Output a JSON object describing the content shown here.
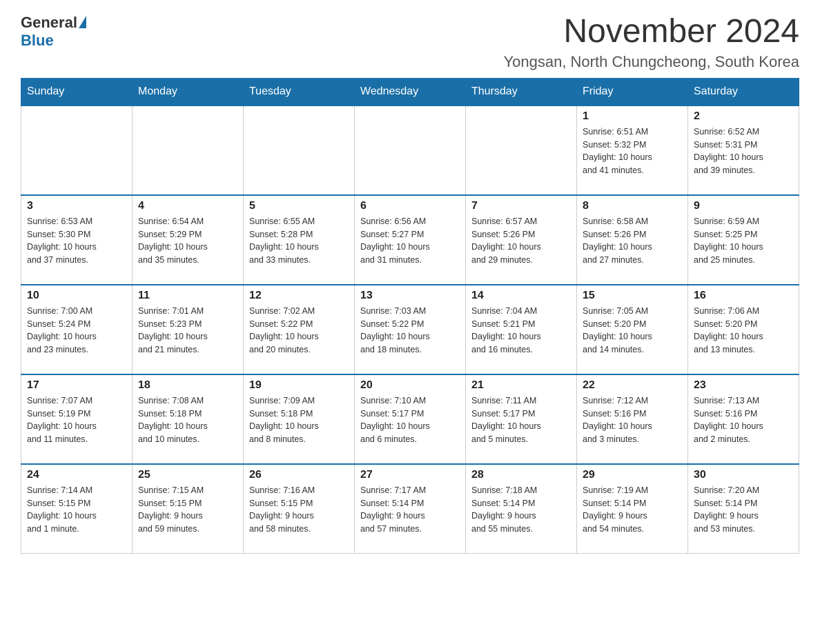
{
  "logo": {
    "general": "General",
    "blue": "Blue"
  },
  "title": "November 2024",
  "location": "Yongsan, North Chungcheong, South Korea",
  "headers": [
    "Sunday",
    "Monday",
    "Tuesday",
    "Wednesday",
    "Thursday",
    "Friday",
    "Saturday"
  ],
  "weeks": [
    [
      {
        "day": "",
        "info": ""
      },
      {
        "day": "",
        "info": ""
      },
      {
        "day": "",
        "info": ""
      },
      {
        "day": "",
        "info": ""
      },
      {
        "day": "",
        "info": ""
      },
      {
        "day": "1",
        "info": "Sunrise: 6:51 AM\nSunset: 5:32 PM\nDaylight: 10 hours\nand 41 minutes."
      },
      {
        "day": "2",
        "info": "Sunrise: 6:52 AM\nSunset: 5:31 PM\nDaylight: 10 hours\nand 39 minutes."
      }
    ],
    [
      {
        "day": "3",
        "info": "Sunrise: 6:53 AM\nSunset: 5:30 PM\nDaylight: 10 hours\nand 37 minutes."
      },
      {
        "day": "4",
        "info": "Sunrise: 6:54 AM\nSunset: 5:29 PM\nDaylight: 10 hours\nand 35 minutes."
      },
      {
        "day": "5",
        "info": "Sunrise: 6:55 AM\nSunset: 5:28 PM\nDaylight: 10 hours\nand 33 minutes."
      },
      {
        "day": "6",
        "info": "Sunrise: 6:56 AM\nSunset: 5:27 PM\nDaylight: 10 hours\nand 31 minutes."
      },
      {
        "day": "7",
        "info": "Sunrise: 6:57 AM\nSunset: 5:26 PM\nDaylight: 10 hours\nand 29 minutes."
      },
      {
        "day": "8",
        "info": "Sunrise: 6:58 AM\nSunset: 5:26 PM\nDaylight: 10 hours\nand 27 minutes."
      },
      {
        "day": "9",
        "info": "Sunrise: 6:59 AM\nSunset: 5:25 PM\nDaylight: 10 hours\nand 25 minutes."
      }
    ],
    [
      {
        "day": "10",
        "info": "Sunrise: 7:00 AM\nSunset: 5:24 PM\nDaylight: 10 hours\nand 23 minutes."
      },
      {
        "day": "11",
        "info": "Sunrise: 7:01 AM\nSunset: 5:23 PM\nDaylight: 10 hours\nand 21 minutes."
      },
      {
        "day": "12",
        "info": "Sunrise: 7:02 AM\nSunset: 5:22 PM\nDaylight: 10 hours\nand 20 minutes."
      },
      {
        "day": "13",
        "info": "Sunrise: 7:03 AM\nSunset: 5:22 PM\nDaylight: 10 hours\nand 18 minutes."
      },
      {
        "day": "14",
        "info": "Sunrise: 7:04 AM\nSunset: 5:21 PM\nDaylight: 10 hours\nand 16 minutes."
      },
      {
        "day": "15",
        "info": "Sunrise: 7:05 AM\nSunset: 5:20 PM\nDaylight: 10 hours\nand 14 minutes."
      },
      {
        "day": "16",
        "info": "Sunrise: 7:06 AM\nSunset: 5:20 PM\nDaylight: 10 hours\nand 13 minutes."
      }
    ],
    [
      {
        "day": "17",
        "info": "Sunrise: 7:07 AM\nSunset: 5:19 PM\nDaylight: 10 hours\nand 11 minutes."
      },
      {
        "day": "18",
        "info": "Sunrise: 7:08 AM\nSunset: 5:18 PM\nDaylight: 10 hours\nand 10 minutes."
      },
      {
        "day": "19",
        "info": "Sunrise: 7:09 AM\nSunset: 5:18 PM\nDaylight: 10 hours\nand 8 minutes."
      },
      {
        "day": "20",
        "info": "Sunrise: 7:10 AM\nSunset: 5:17 PM\nDaylight: 10 hours\nand 6 minutes."
      },
      {
        "day": "21",
        "info": "Sunrise: 7:11 AM\nSunset: 5:17 PM\nDaylight: 10 hours\nand 5 minutes."
      },
      {
        "day": "22",
        "info": "Sunrise: 7:12 AM\nSunset: 5:16 PM\nDaylight: 10 hours\nand 3 minutes."
      },
      {
        "day": "23",
        "info": "Sunrise: 7:13 AM\nSunset: 5:16 PM\nDaylight: 10 hours\nand 2 minutes."
      }
    ],
    [
      {
        "day": "24",
        "info": "Sunrise: 7:14 AM\nSunset: 5:15 PM\nDaylight: 10 hours\nand 1 minute."
      },
      {
        "day": "25",
        "info": "Sunrise: 7:15 AM\nSunset: 5:15 PM\nDaylight: 9 hours\nand 59 minutes."
      },
      {
        "day": "26",
        "info": "Sunrise: 7:16 AM\nSunset: 5:15 PM\nDaylight: 9 hours\nand 58 minutes."
      },
      {
        "day": "27",
        "info": "Sunrise: 7:17 AM\nSunset: 5:14 PM\nDaylight: 9 hours\nand 57 minutes."
      },
      {
        "day": "28",
        "info": "Sunrise: 7:18 AM\nSunset: 5:14 PM\nDaylight: 9 hours\nand 55 minutes."
      },
      {
        "day": "29",
        "info": "Sunrise: 7:19 AM\nSunset: 5:14 PM\nDaylight: 9 hours\nand 54 minutes."
      },
      {
        "day": "30",
        "info": "Sunrise: 7:20 AM\nSunset: 5:14 PM\nDaylight: 9 hours\nand 53 minutes."
      }
    ]
  ]
}
